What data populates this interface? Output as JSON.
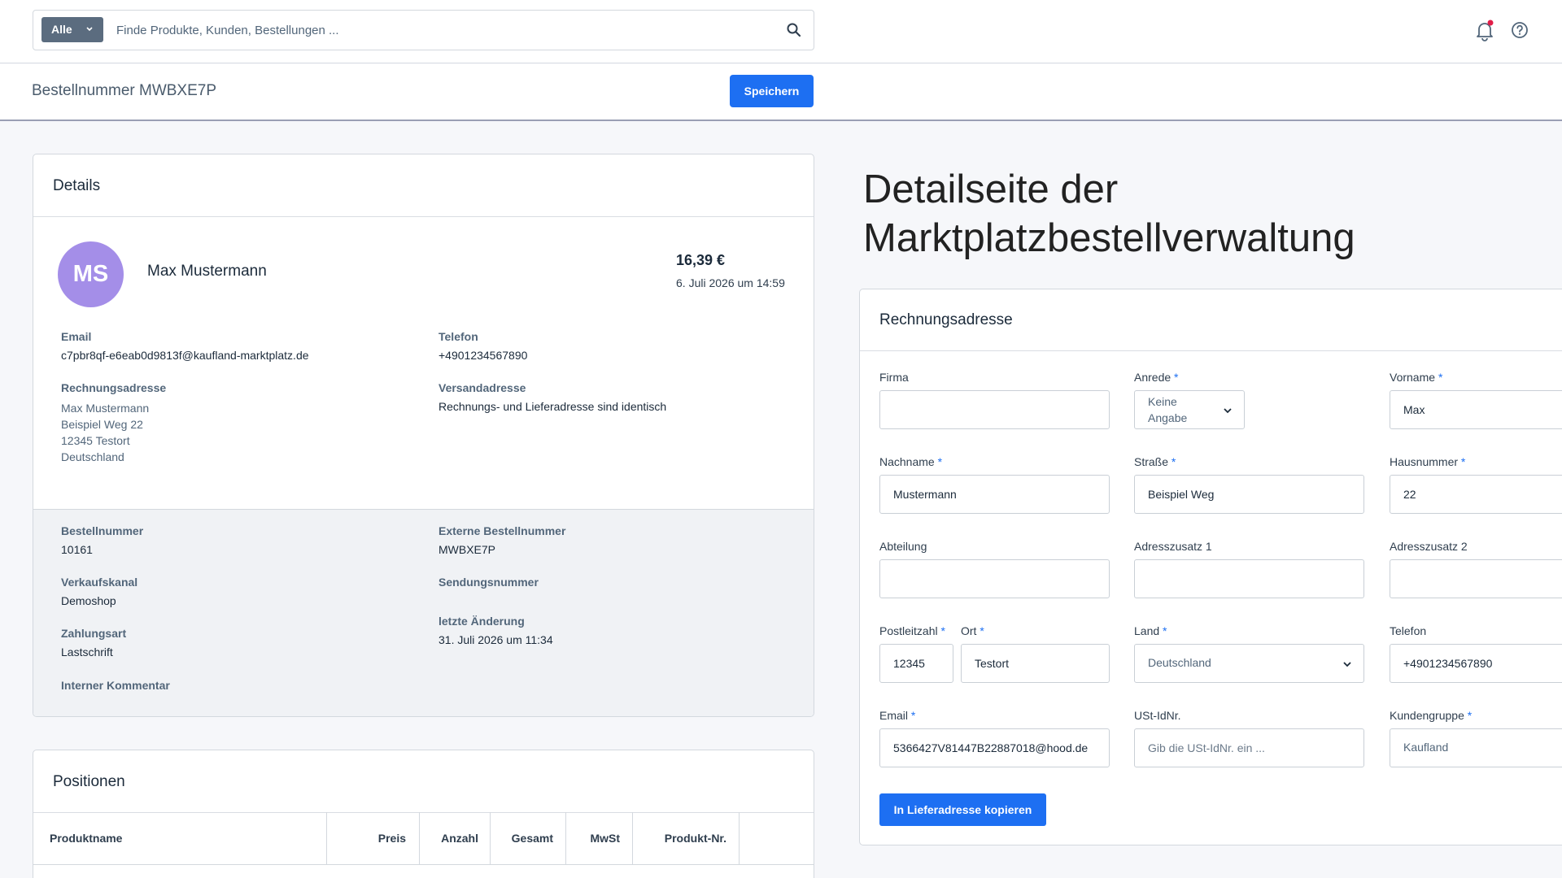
{
  "search": {
    "scope": "Alle",
    "placeholder": "Finde Produkte, Kunden, Bestellungen ..."
  },
  "header": {
    "title": "Bestellnummer MWBXE7P",
    "save_label": "Speichern"
  },
  "details": {
    "title": "Details",
    "avatar_initials": "MS",
    "customer_name": "Max Mustermann",
    "total": "16,39 €",
    "order_date": "6. Juli 2026 um 14:59",
    "email_label": "Email",
    "email_value": "c7pbr8qf-e6eab0d9813f@kaufland-marktplatz.de",
    "phone_label": "Telefon",
    "phone_value": "+4901234567890",
    "billing_label": "Rechnungsadresse",
    "billing_lines": [
      "Max Mustermann",
      "Beispiel Weg 22",
      "12345 Testort",
      "Deutschland"
    ],
    "shipping_label": "Versandadresse",
    "shipping_value": "Rechnungs- und Lieferadresse sind identisch",
    "order_number_label": "Bestellnummer",
    "order_number_value": "10161",
    "external_order_label": "Externe Bestellnummer",
    "external_order_value": "MWBXE7P",
    "sales_channel_label": "Verkaufskanal",
    "sales_channel_value": "Demoshop",
    "tracking_label": "Sendungsnummer",
    "payment_label": "Zahlungsart",
    "payment_value": "Lastschrift",
    "last_change_label": "letzte Änderung",
    "last_change_value": "31. Juli 2026 um 11:34",
    "internal_comment_label": "Interner Kommentar"
  },
  "positions": {
    "title": "Positionen",
    "columns": [
      "Produktname",
      "Preis",
      "Anzahl",
      "Gesamt",
      "MwSt",
      "Produkt-Nr."
    ]
  },
  "page_heading": "Detailseite der Marktplatzbestellverwaltung",
  "billing_form": {
    "title": "Rechnungsadresse",
    "company_label": "Firma",
    "company_value": "",
    "salutation_label": "Anrede",
    "salutation_value": "Keine Angabe",
    "firstname_label": "Vorname",
    "firstname_value": "Max",
    "lastname_label": "Nachname",
    "lastname_value": "Mustermann",
    "street_label": "Straße",
    "street_value": "Beispiel Weg",
    "housenumber_label": "Hausnummer",
    "housenumber_value": "22",
    "department_label": "Abteilung",
    "department_value": "",
    "address1_label": "Adresszusatz 1",
    "address1_value": "",
    "address2_label": "Adresszusatz 2",
    "address2_value": "",
    "zip_label": "Postleitzahl",
    "zip_value": "12345",
    "city_label": "Ort",
    "city_value": "Testort",
    "country_label": "Land",
    "country_value": "Deutschland",
    "phone_label": "Telefon",
    "phone_value": "+4901234567890",
    "email_label": "Email",
    "email_value": "5366427V81447B22887018@hood.de",
    "vat_label": "USt-IdNr.",
    "vat_placeholder": "Gib die USt-IdNr. ein ...",
    "customer_group_label": "Kundengruppe",
    "customer_group_value": "Kaufland",
    "required_mark": "*",
    "copy_button_label": "In Lieferadresse kopieren"
  }
}
